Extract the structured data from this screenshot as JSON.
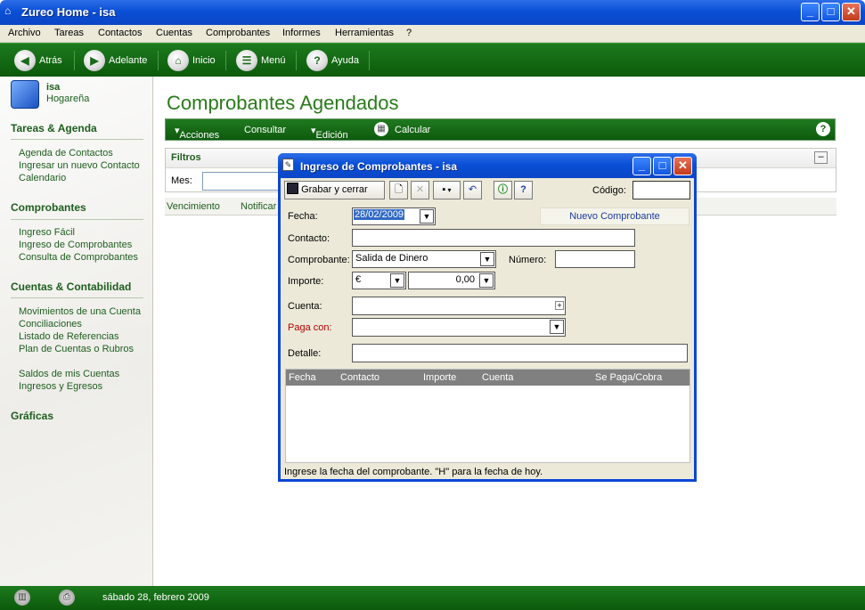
{
  "window": {
    "title": "Zureo Home - isa",
    "icon": "home-icon"
  },
  "menu": [
    "Archivo",
    "Tareas",
    "Contactos",
    "Cuentas",
    "Comprobantes",
    "Informes",
    "Herramientas",
    "?"
  ],
  "toolbar": {
    "back": "Atrás",
    "forward": "Adelante",
    "home": "Inicio",
    "menu": "Menú",
    "help": "Ayuda"
  },
  "sidebar": {
    "user_name": "isa",
    "user_type": "Hogareña",
    "sections": {
      "tareas": {
        "title": "Tareas & Agenda",
        "items": [
          "Agenda de Contactos",
          "Ingresar un nuevo Contacto",
          "Calendario"
        ]
      },
      "comprobantes": {
        "title": "Comprobantes",
        "items": [
          "Ingreso Fácil",
          "Ingreso de Comprobantes",
          "Consulta de Comprobantes"
        ]
      },
      "cuentas": {
        "title": "Cuentas & Contabilidad",
        "items": [
          "Movimientos de una Cuenta",
          "Conciliaciones",
          "Listado de Referencias",
          "Plan de Cuentas o Rubros",
          "Saldos de mis Cuentas",
          "Ingresos y Egresos"
        ]
      },
      "graficas": {
        "title": "Gráficas"
      }
    }
  },
  "content": {
    "title": "Comprobantes Agendados",
    "actions": {
      "acciones": "Acciones",
      "consultar": "Consultar",
      "edicion": "Edición",
      "calcular": "Calcular",
      "help": "?"
    },
    "filtros": {
      "title": "Filtros",
      "mes_label": "Mes:",
      "collapse": "–"
    },
    "columns": {
      "vencimiento": "Vencimiento",
      "notificar": "Notificar"
    }
  },
  "status": {
    "date": "sábado 28, febrero 2009"
  },
  "dialog": {
    "title": "Ingreso de Comprobantes - isa",
    "save_close": "Grabar y cerrar",
    "codigo_label": "Código:",
    "codigo_value": "",
    "badge": "Nuevo Comprobante",
    "fecha_label": "Fecha:",
    "fecha_value": "28/02/2009",
    "contacto_label": "Contacto:",
    "comprobante_label": "Comprobante:",
    "comprobante_value": "Salida de Dinero",
    "numero_label": "Número:",
    "importe_label": "Importe:",
    "currency": "€",
    "amount": "0,00",
    "cuenta_label": "Cuenta:",
    "paga_con_label": "Paga con:",
    "detalle_label": "Detalle:",
    "grid_columns": {
      "fecha": "Fecha",
      "contacto": "Contacto",
      "importe": "Importe",
      "cuenta": "Cuenta",
      "se_paga": "Se Paga/Cobra"
    },
    "hint": "Ingrese la fecha del comprobante. \"H\" para la fecha de hoy."
  },
  "colors": {
    "green": "#0b5a0b",
    "xp_blue": "#0a4fd6",
    "link_green": "#1e5e1e",
    "label_red": "#b00000"
  }
}
